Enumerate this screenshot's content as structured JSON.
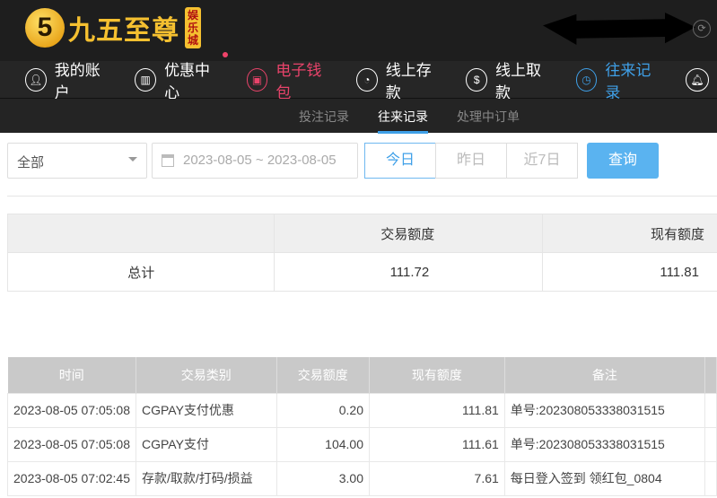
{
  "header": {
    "logo_mark": "5",
    "logo_text": "九五至尊",
    "logo_badge": "娱乐城"
  },
  "nav": [
    {
      "label": "我的账户",
      "icon": "user-icon"
    },
    {
      "label": "优惠中心",
      "icon": "gift-icon"
    },
    {
      "label": "电子钱包",
      "icon": "wallet-icon"
    },
    {
      "label": "线上存款",
      "icon": "deposit-icon"
    },
    {
      "label": "线上取款",
      "icon": "withdraw-icon"
    },
    {
      "label": "往来记录",
      "icon": "records-icon"
    }
  ],
  "subnav": [
    "投注记录",
    "往来记录",
    "处理中订单"
  ],
  "filter": {
    "type": "全部",
    "date_range": "2023-08-05 ~ 2023-08-05",
    "quick": [
      "今日",
      "昨日",
      "近7日"
    ],
    "search": "查询"
  },
  "summary": {
    "headers": [
      "",
      "交易额度",
      "现有额度"
    ],
    "row": [
      "总计",
      "111.72",
      "111.81"
    ]
  },
  "table": {
    "headers": [
      "时间",
      "交易类别",
      "交易额度",
      "现有额度",
      "备注"
    ],
    "rows": [
      [
        "2023-08-05 07:05:08",
        "CGPAY支付优惠",
        "0.20",
        "111.81",
        "单号:202308053338031515"
      ],
      [
        "2023-08-05 07:05:08",
        "CGPAY支付",
        "104.00",
        "111.61",
        "单号:202308053338031515"
      ],
      [
        "2023-08-05 07:02:45",
        "存款/取款/打码/损益",
        "3.00",
        "7.61",
        "每日登入签到 领红包_0804"
      ]
    ]
  },
  "colors": {
    "active_red": "#e8436a",
    "active_blue": "#3fa0e8"
  }
}
